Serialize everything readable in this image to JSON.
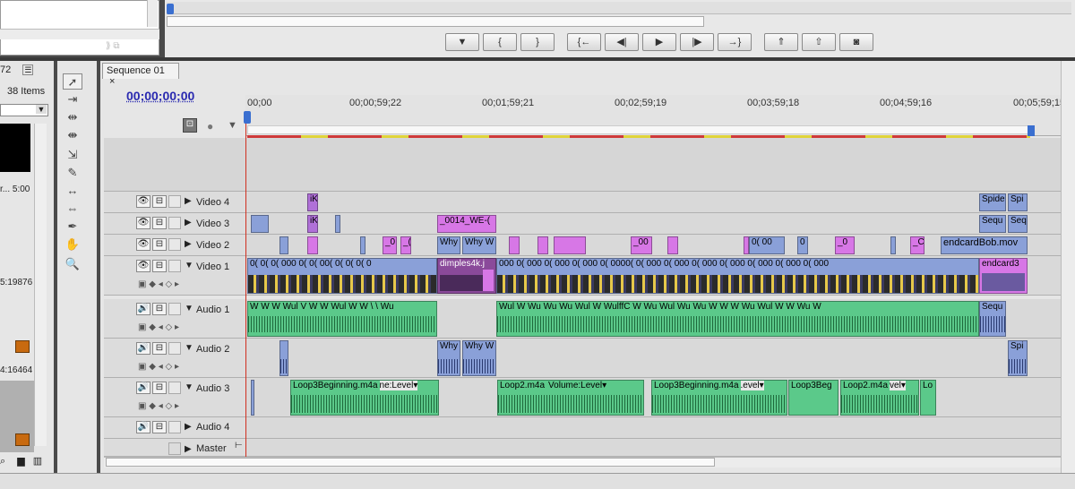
{
  "project": {
    "items_count": "38 Items",
    "tab_label": "72",
    "duration": "r... 5:00",
    "item2": "5:19876",
    "item3": "4:16464"
  },
  "transport": {
    "buttons": [
      {
        "name": "add-marker-button",
        "glyph": "▼"
      },
      {
        "name": "mark-in-button",
        "glyph": "{"
      },
      {
        "name": "mark-out-button",
        "glyph": "}"
      },
      {
        "name": "go-to-in-button",
        "glyph": "{←"
      },
      {
        "name": "step-back-button",
        "glyph": "◀|"
      },
      {
        "name": "play-button",
        "glyph": "▶"
      },
      {
        "name": "step-forward-button",
        "glyph": "|▶"
      },
      {
        "name": "go-to-out-button",
        "glyph": "→}"
      },
      {
        "name": "lift-button",
        "glyph": "⇑"
      },
      {
        "name": "extract-button",
        "glyph": "⇧"
      },
      {
        "name": "export-frame-button",
        "glyph": "◙"
      }
    ]
  },
  "sequence": {
    "tab_label": "Sequence 01",
    "close_glyph": "×",
    "timecode": "00;00;00;00",
    "ruler": [
      "00;00",
      "00;00;59;22",
      "00;01;59;21",
      "00;02;59;19",
      "00;03;59;18",
      "00;04;59;16",
      "00;05;59;15"
    ]
  },
  "tracks": {
    "video4": "Video 4",
    "video3": "Video 3",
    "video2": "Video 2",
    "video1": "Video 1",
    "audio1": "Audio 1",
    "audio2": "Audio 2",
    "audio3": "Audio 3",
    "audio4": "Audio 4",
    "master": "Master"
  },
  "clips": {
    "v4_spide": "Spide",
    "v4_spi": "Spi",
    "v3_we": "_0014_WE-(",
    "v3_sequ": "Sequ",
    "v3_seq": "Seq",
    "v2_why1": "Why",
    "v2_why2": "Why W",
    "v2_endcard": "endcardBob.mov",
    "v1_dimples": "dimples4k.j",
    "v1_endcard": "endcard3",
    "a1_sequ": "Sequ",
    "a2_why1": "Why",
    "a2_why2": "Why W",
    "a2_spi": "Spi",
    "a3_loop3a": "Loop3Beginning.m4a",
    "a3_level1": "ne:Level▾",
    "a3_loop2a": "Loop2.m4a",
    "a3_volume": "Volume:Level▾",
    "a3_loop3b": "Loop3Beginning.m4a",
    "a3_level2": ".evel▾",
    "a3_loop3beg": "Loop3Beg",
    "a3_loop2b": "Loop2.m4a",
    "a3_vel": "vel▾",
    "a3_lo": "Lo"
  },
  "colors": {
    "accent": "#2a2ab0",
    "playhead": "#d03020",
    "video_clip": "#8aa0d8",
    "pink_clip": "#d777e6",
    "audio_clip": "#5bc98a"
  }
}
